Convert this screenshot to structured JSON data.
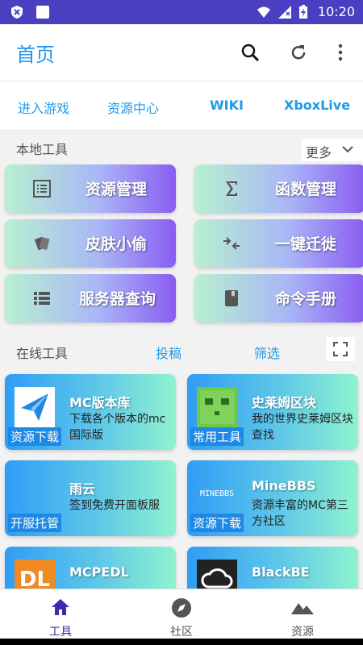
{
  "status_bar": {
    "time": "10:20"
  },
  "app_bar": {
    "title": "首页"
  },
  "tabs": [
    "进入游戏",
    "资源中心",
    "WIKI",
    "XboxLive"
  ],
  "local_tools": {
    "heading": "本地工具",
    "more": "更多",
    "items": [
      {
        "label": "资源管理",
        "icon": "list-icon"
      },
      {
        "label": "函数管理",
        "icon": "sigma-icon"
      },
      {
        "label": "皮肤小偷",
        "icon": "cards-icon"
      },
      {
        "label": "一键迁徙",
        "icon": "merge-arrows-icon"
      },
      {
        "label": "服务器查询",
        "icon": "server-list-icon"
      },
      {
        "label": "命令手册",
        "icon": "book-icon"
      }
    ]
  },
  "online_tools": {
    "heading": "在线工具",
    "submit": "投稿",
    "filter": "筛选",
    "items": [
      {
        "name": "MC版本库",
        "desc": "下载各个版本的mc国际版",
        "tag": "资源下载",
        "thumb": "paper-plane-icon"
      },
      {
        "name": "史莱姆区块",
        "desc": "我的世界史莱姆区块查找",
        "tag": "常用工具",
        "thumb": "slime-icon"
      },
      {
        "name": "雨云",
        "desc": "签到免费开面板服",
        "tag": "开服托管",
        "thumb": ""
      },
      {
        "name": "MineBBS",
        "desc": "资源丰富的MC第三方社区",
        "tag": "资源下载",
        "thumb": "MINEBBS"
      },
      {
        "name": "MCPEDL",
        "desc": "",
        "tag": "",
        "thumb": "DL"
      },
      {
        "name": "BlackBE",
        "desc": "",
        "tag": "",
        "thumb": "cloud-icon"
      }
    ]
  },
  "bottom_nav": [
    {
      "label": "工具",
      "icon": "home-icon",
      "active": true
    },
    {
      "label": "社区",
      "icon": "compass-icon",
      "active": false
    },
    {
      "label": "资源",
      "icon": "mountain-icon",
      "active": false
    }
  ],
  "colors": {
    "accent": "#2196f3",
    "nav_active": "#3d2bb0",
    "status_bar": "#4a3fc1"
  }
}
